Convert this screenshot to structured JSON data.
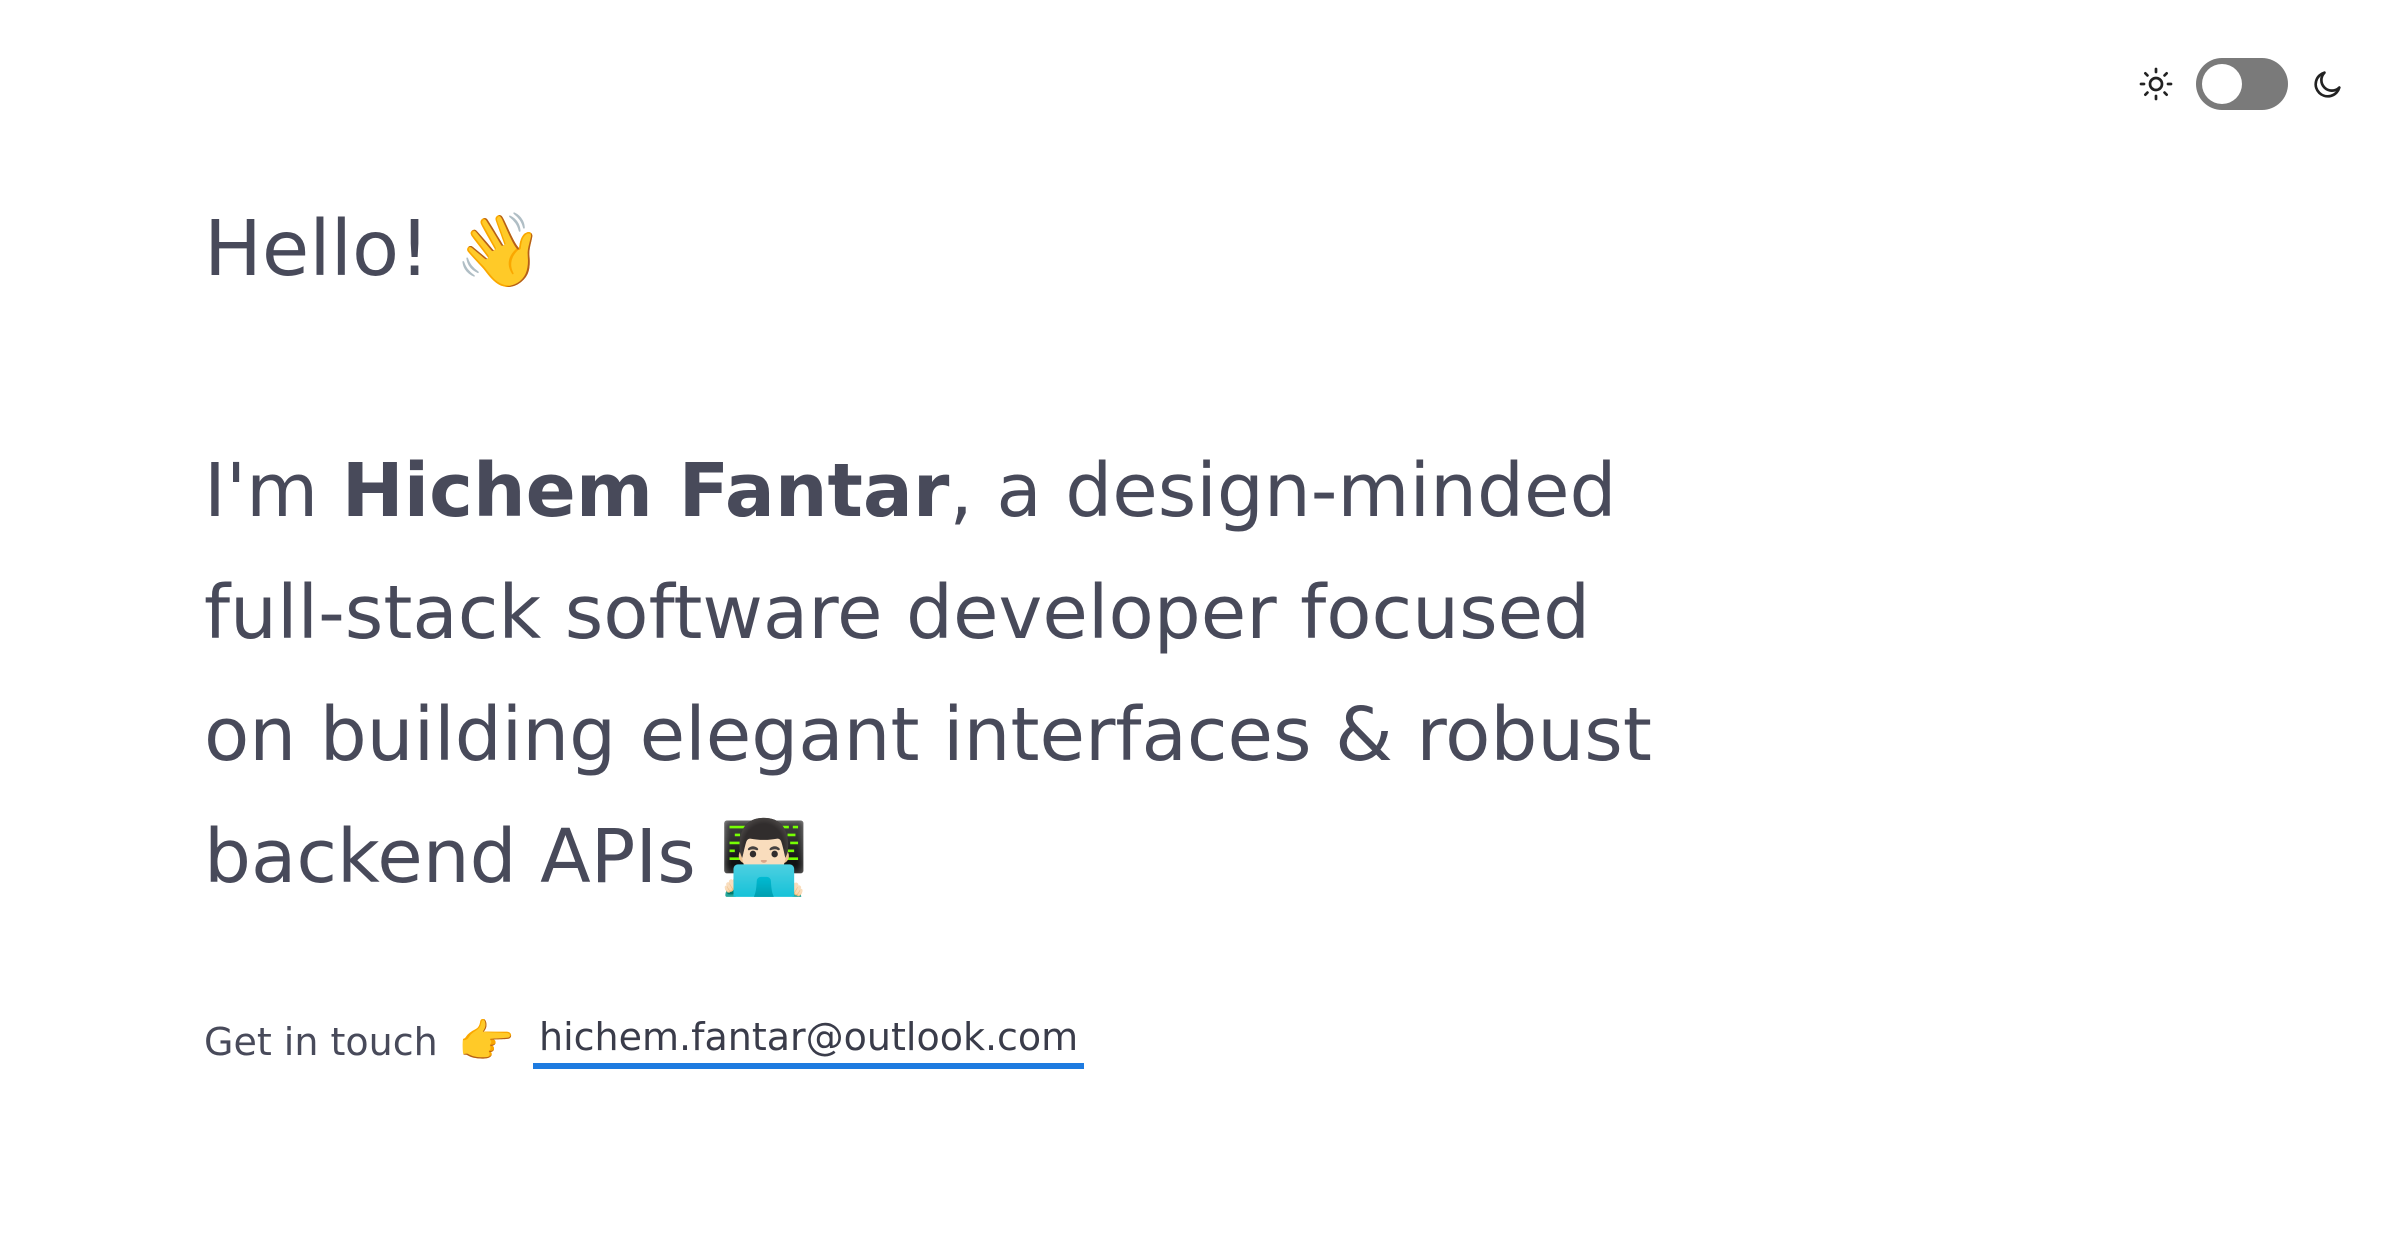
{
  "theme_toggle": {
    "light_icon": "sun-icon",
    "dark_icon": "moon-icon",
    "state": "light",
    "track_color": "#7a7a7a"
  },
  "hero": {
    "greeting": "Hello!",
    "greeting_emoji": "👋",
    "intro_prefix": "I'm ",
    "name": "Hichem Fantar",
    "intro_text": ", a design-minded full-stack software developer focused on building elegant interfaces & robust backend APIs",
    "intro_emoji": "👨🏻‍💻"
  },
  "contact": {
    "label": "Get in touch",
    "pointer_emoji": "👉",
    "email": "hichem.fantar@outlook.com",
    "link_underline_color": "#1e7be0"
  }
}
